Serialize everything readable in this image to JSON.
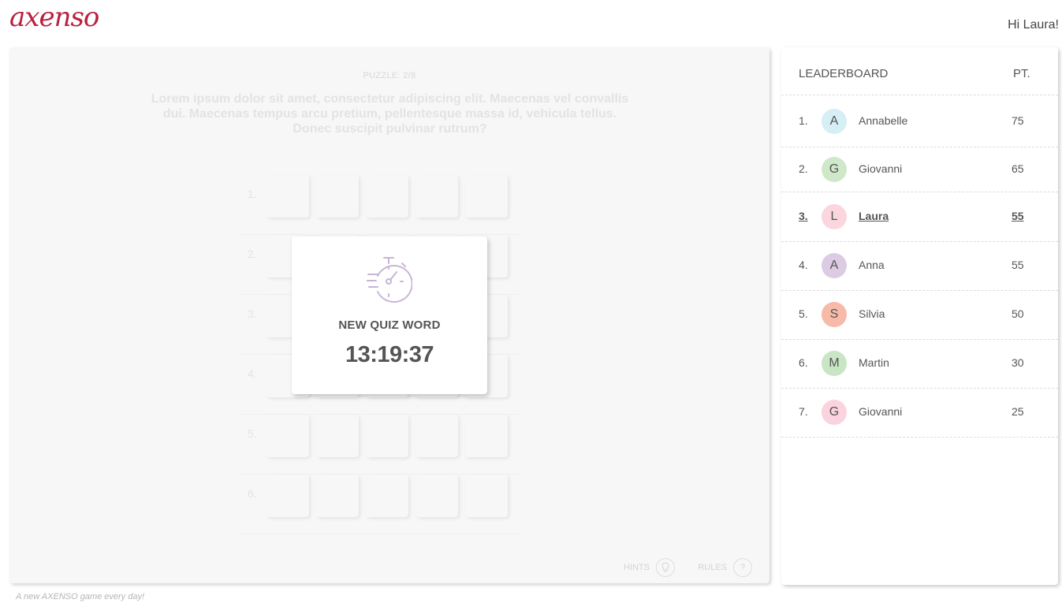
{
  "header": {
    "logo_text": "axenso",
    "greeting": "Hi Laura!"
  },
  "game": {
    "puzzle_counter": "PUZZLE: 2/8",
    "question": "Lorem ipsum dolor sit amet, consectetur adipiscing elit. Maecenas vel convallis dui. Maecenas tempus arcu pretium, pellentesque massa id, vehicula tellus. Donec suscipit pulvinar rutrum?",
    "rows": [
      {
        "number": "1."
      },
      {
        "number": "2."
      },
      {
        "number": "3."
      },
      {
        "number": "4."
      },
      {
        "number": "5."
      },
      {
        "number": "6."
      }
    ],
    "cells_per_row": 5,
    "hints_label": "HINTS",
    "rules_label": "RULES",
    "rules_icon_glyph": "?"
  },
  "modal": {
    "icon": "stopwatch-icon",
    "label": "NEW QUIZ WORD",
    "timer": "13:19:37"
  },
  "leaderboard": {
    "title": "LEADERBOARD",
    "points_header": "PT.",
    "entries": [
      {
        "rank": "1.",
        "initial": "A",
        "name": "Annabelle",
        "score": "75",
        "color": "#d6eef5",
        "current": false
      },
      {
        "rank": "2.",
        "initial": "G",
        "name": "Giovanni",
        "score": "65",
        "color": "#cfe8c9",
        "current": false
      },
      {
        "rank": "3.",
        "initial": "L",
        "name": "Laura",
        "score": "55",
        "color": "#fbd6df",
        "current": true
      },
      {
        "rank": "4.",
        "initial": "A",
        "name": "Anna",
        "score": "55",
        "color": "#dccbe3",
        "current": false
      },
      {
        "rank": "5.",
        "initial": "S",
        "name": "Silvia",
        "score": "50",
        "color": "#f7b9a8",
        "current": false
      },
      {
        "rank": "6.",
        "initial": "M",
        "name": "Martin",
        "score": "30",
        "color": "#c8e6c3",
        "current": false
      },
      {
        "rank": "7.",
        "initial": "G",
        "name": "Giovanni",
        "score": "25",
        "color": "#fbd3de",
        "current": false
      }
    ]
  },
  "footer": {
    "tagline": "A new AXENSO game every day!"
  },
  "colors": {
    "brand": "#b8203e",
    "modal_icon": "#c9b4d8"
  }
}
